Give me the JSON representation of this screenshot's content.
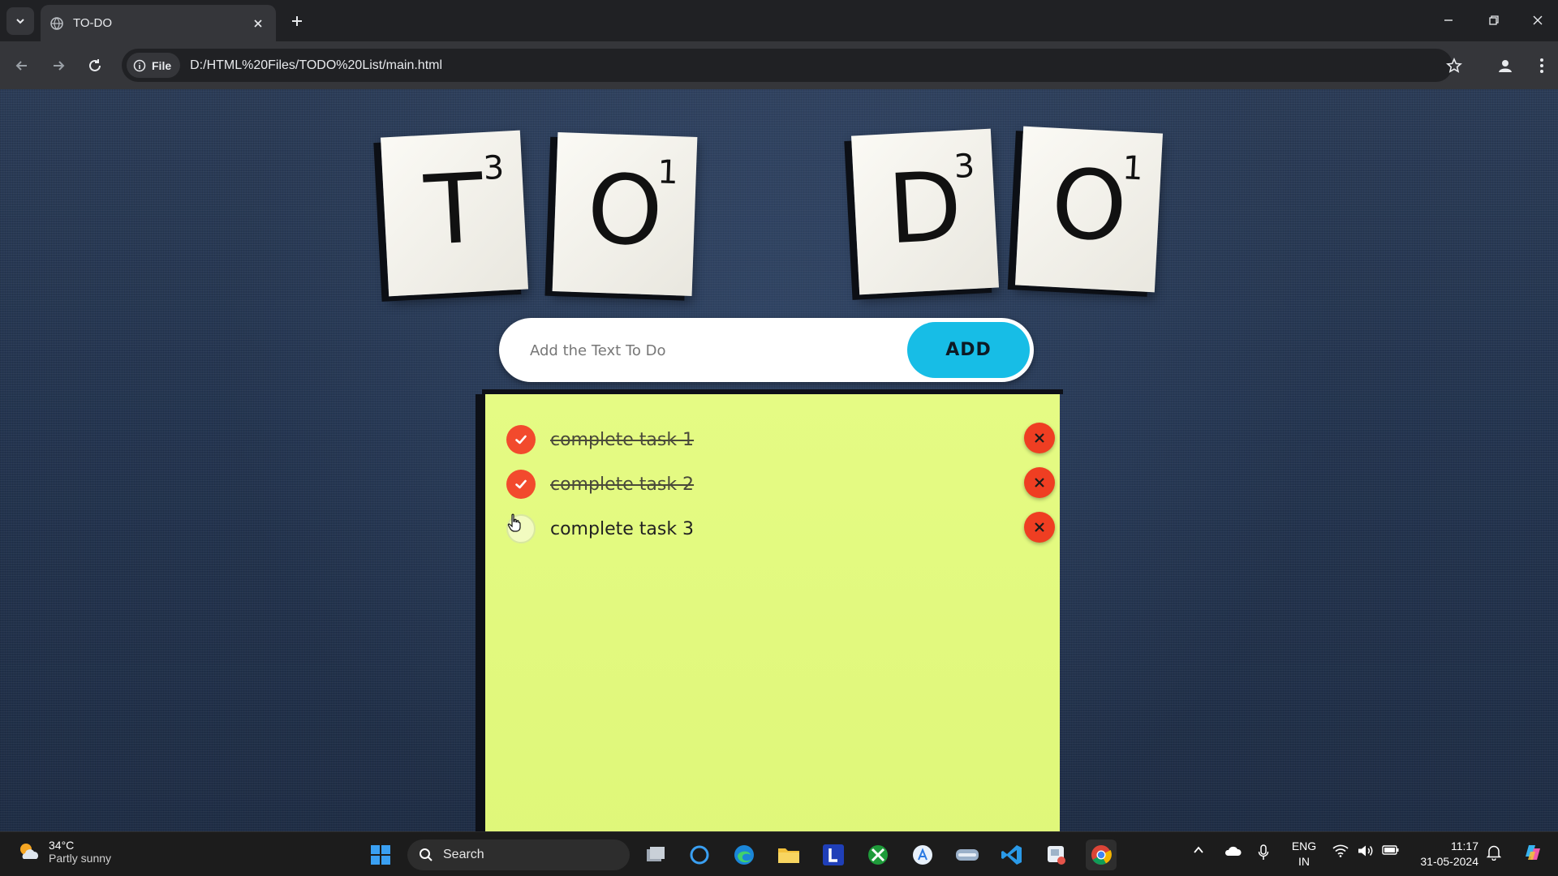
{
  "browser": {
    "tab_title": "TO-DO",
    "scheme_chip": "File",
    "url": "D:/HTML%20Files/TODO%20List/main.html"
  },
  "app": {
    "tiles": [
      {
        "letter": "T",
        "score": "3"
      },
      {
        "letter": "O",
        "score": "1"
      },
      {
        "letter": "D",
        "score": "3"
      },
      {
        "letter": "O",
        "score": "1"
      }
    ],
    "input": {
      "placeholder": "Add the Text To Do",
      "value": ""
    },
    "add_label": "ADD",
    "tasks": [
      {
        "text": "complete task 1",
        "done": true
      },
      {
        "text": "complete task 2",
        "done": true
      },
      {
        "text": "complete task 3",
        "done": false
      }
    ],
    "colors": {
      "accent_add": "#17bde6",
      "sticky_note": "#e2f97f",
      "done_check": "#f24a2d",
      "delete": "#ef3e22"
    }
  },
  "taskbar": {
    "weather_temp": "34°C",
    "weather_condition": "Partly sunny",
    "search_label": "Search",
    "lang_line1": "ENG",
    "lang_line2": "IN",
    "time": "11:17",
    "date": "31-05-2024"
  }
}
